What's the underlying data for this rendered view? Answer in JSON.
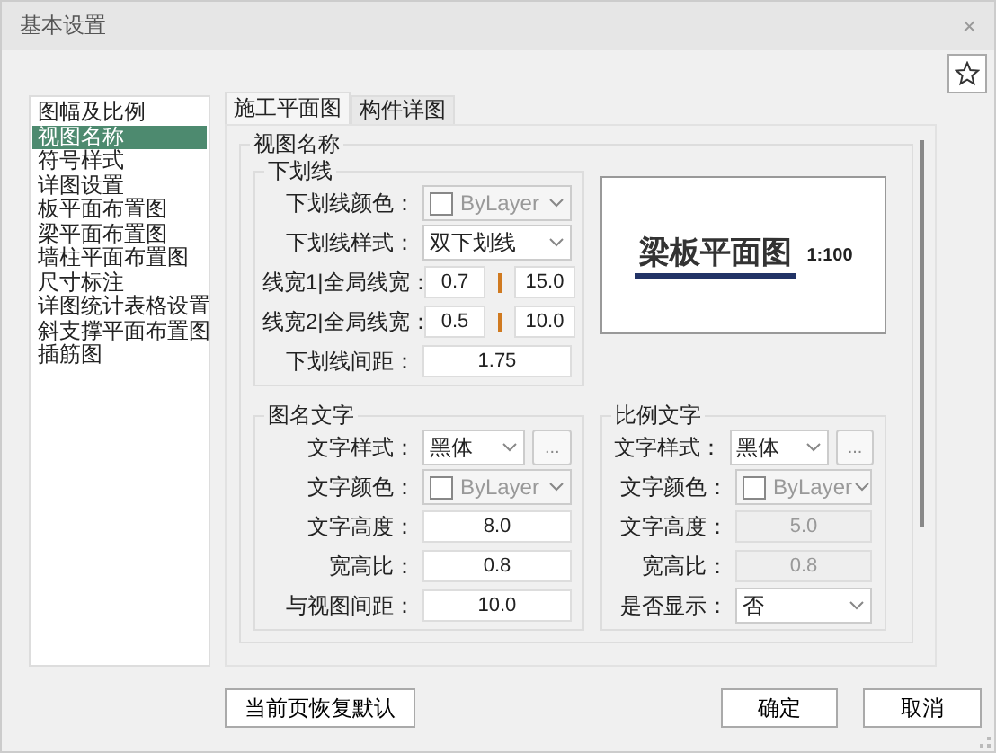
{
  "window": {
    "title": "基本设置",
    "close": "×"
  },
  "sidebar": {
    "items": [
      {
        "label": "图幅及比例",
        "selected": false
      },
      {
        "label": "视图名称",
        "selected": true
      },
      {
        "label": "符号样式",
        "selected": false
      },
      {
        "label": "详图设置",
        "selected": false
      },
      {
        "label": "板平面布置图",
        "selected": false
      },
      {
        "label": "梁平面布置图",
        "selected": false
      },
      {
        "label": "墙柱平面布置图",
        "selected": false
      },
      {
        "label": "尺寸标注",
        "selected": false
      },
      {
        "label": "详图统计表格设置",
        "selected": false
      },
      {
        "label": "斜支撑平面布置图",
        "selected": false
      },
      {
        "label": "插筋图",
        "selected": false
      }
    ]
  },
  "tabs": [
    {
      "label": "施工平面图",
      "selected": true
    },
    {
      "label": "构件详图",
      "selected": false
    }
  ],
  "group": {
    "title": "视图名称"
  },
  "underline": {
    "title": "下划线",
    "rows": [
      {
        "kind": "color",
        "label": "下划线颜色：",
        "value": "ByLayer",
        "disabled": true
      },
      {
        "kind": "select",
        "label": "下划线样式：",
        "value": "双下划线"
      },
      {
        "kind": "pair",
        "label": "线宽1|全局线宽：",
        "value": "0.7",
        "value2": "15.0"
      },
      {
        "kind": "pair",
        "label": "线宽2|全局线宽：",
        "value": "0.5",
        "value2": "10.0"
      },
      {
        "kind": "input",
        "label": "下划线间距：",
        "value": "1.75",
        "disabled": false
      }
    ]
  },
  "preview": {
    "title": "梁板平面图",
    "scale": "1:100"
  },
  "name_text": {
    "title": "图名文字",
    "rows": [
      {
        "kind": "select_more",
        "label": "文字样式：",
        "value": "黑体",
        "more": "..."
      },
      {
        "kind": "color",
        "label": "文字颜色：",
        "value": "ByLayer",
        "disabled": true
      },
      {
        "kind": "input",
        "label": "文字高度：",
        "value": "8.0",
        "disabled": false
      },
      {
        "kind": "input",
        "label": "宽高比：",
        "value": "0.8",
        "disabled": false
      },
      {
        "kind": "input",
        "label": "与视图间距：",
        "value": "10.0",
        "disabled": false
      }
    ]
  },
  "scale_text": {
    "title": "比例文字",
    "rows": [
      {
        "kind": "select_more",
        "label": "文字样式：",
        "value": "黑体",
        "more": "..."
      },
      {
        "kind": "color",
        "label": "文字颜色：",
        "value": "ByLayer",
        "disabled": true
      },
      {
        "kind": "input",
        "label": "文字高度：",
        "value": "5.0",
        "disabled": true
      },
      {
        "kind": "input",
        "label": "宽高比：",
        "value": "0.8",
        "disabled": true
      },
      {
        "kind": "select",
        "label": "是否显示：",
        "value": "否"
      }
    ]
  },
  "buttons": [
    {
      "label": "当前页恢复默认"
    },
    {
      "label": "确定"
    },
    {
      "label": "取消"
    }
  ]
}
